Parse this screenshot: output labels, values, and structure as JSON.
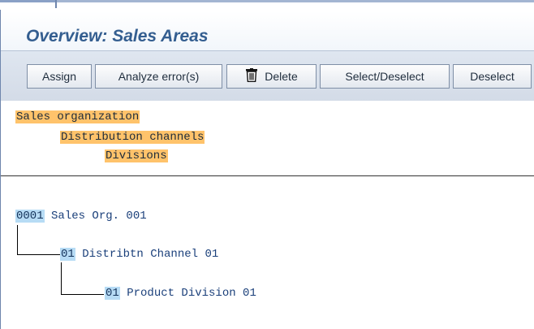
{
  "title": "Overview: Sales Areas",
  "toolbar": {
    "assign": "Assign",
    "analyze": "Analyze error(s)",
    "delete": "Delete",
    "select_deselect": "Select/Deselect",
    "deselect": "Deselect"
  },
  "legend": {
    "sales_org": "Sales organization",
    "dist_channels": "Distribution channels",
    "divisions": "Divisions"
  },
  "tree": {
    "org": {
      "code": "0001",
      "name": "Sales Org. 001"
    },
    "channel": {
      "code": "01",
      "name": "Distribtn Channel 01"
    },
    "division": {
      "code": "01",
      "name": "Product Division 01"
    }
  },
  "colors": {
    "title": "#345e90",
    "legend_highlight": "#ffc36b",
    "key_highlight": "#b7dcf5"
  },
  "icons": {
    "delete": "trash-icon"
  }
}
